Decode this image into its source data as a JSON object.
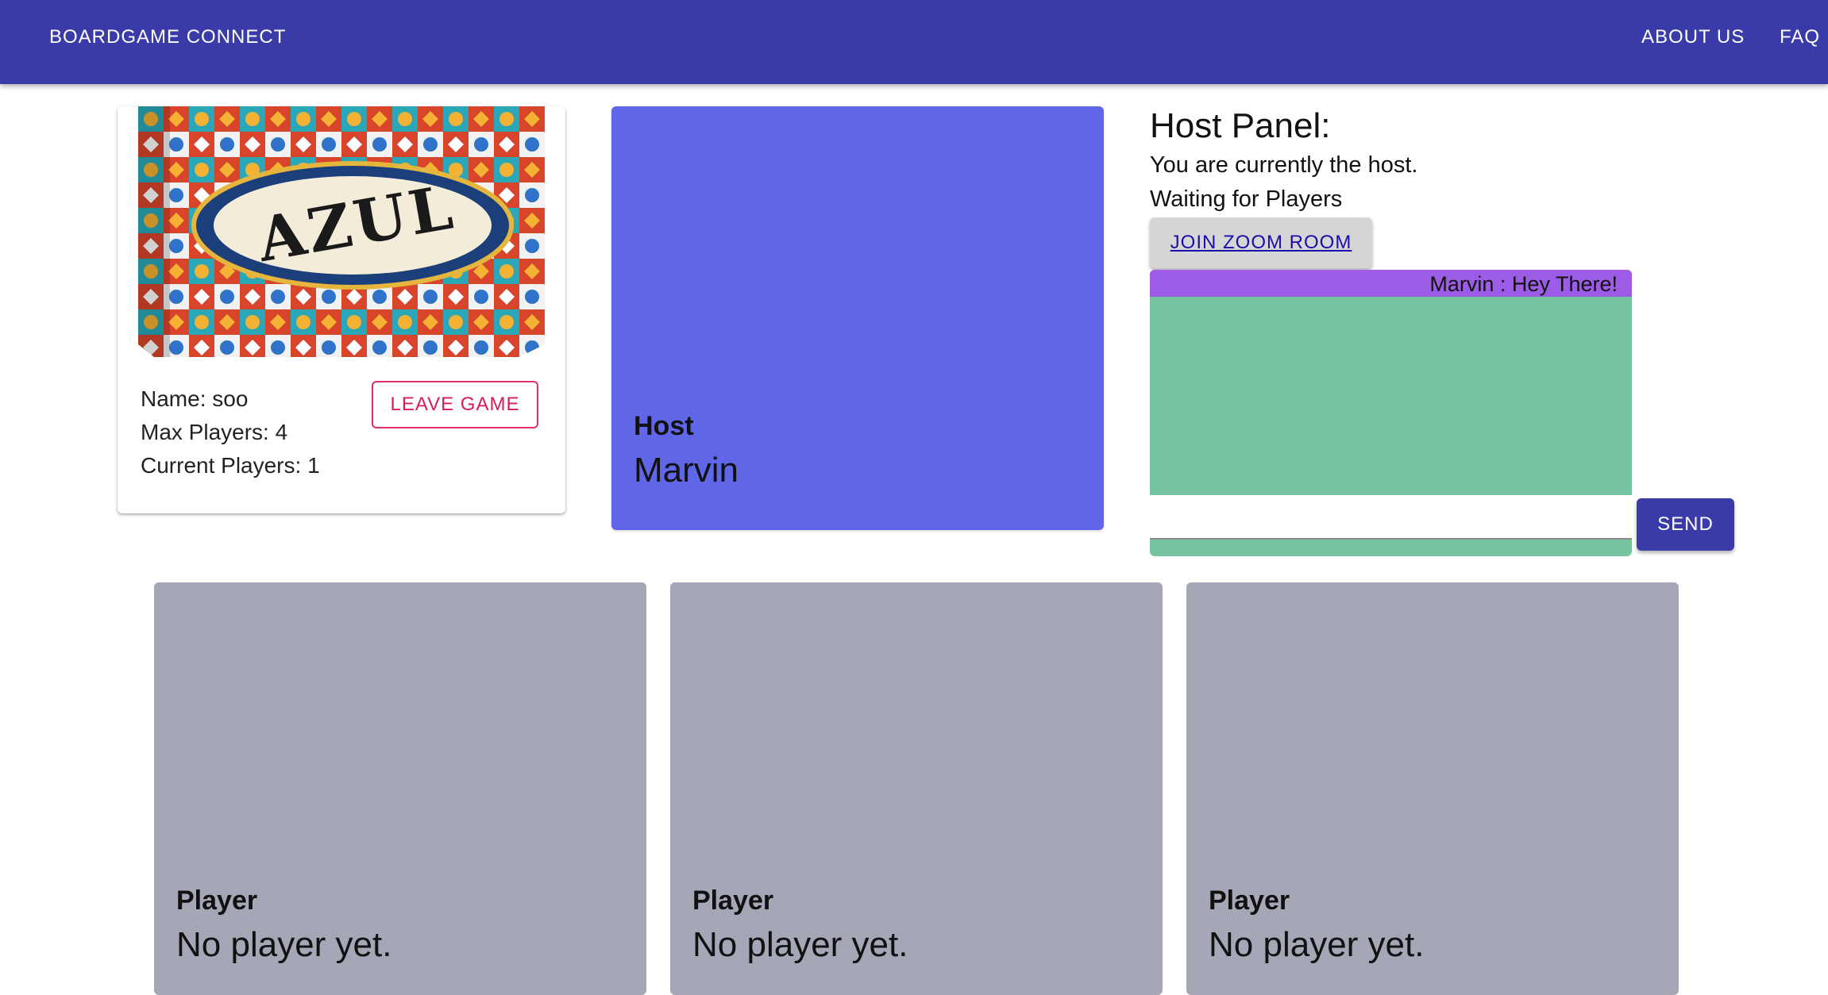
{
  "appbar": {
    "brand": "BOARDGAME CONNECT",
    "nav": [
      "ABOUT US",
      "FAQ"
    ],
    "color": "#3a3aa8"
  },
  "game": {
    "image_alt": "AZUL",
    "name_line": "Name: soo",
    "max_players_line": "Max Players: 4",
    "current_players_line": "Current Players: 1",
    "leave_label": "LEAVE GAME"
  },
  "host_tile": {
    "role": "Host",
    "name": "Marvin",
    "color": "#5f67e8"
  },
  "host_panel": {
    "title": "Host Panel:",
    "status_line": "You are currently the host.",
    "waiting_line": "Waiting for Players",
    "zoom_label": "JOIN ZOOM ROOM"
  },
  "chat": {
    "messages": [
      "Marvin : Hey There!"
    ],
    "input_value": "",
    "send_label": "SEND",
    "background": "#79c4a0",
    "message_color": "#9d5ce6"
  },
  "players": [
    {
      "role": "Player",
      "name": "No player yet."
    },
    {
      "role": "Player",
      "name": "No player yet."
    },
    {
      "role": "Player",
      "name": "No player yet."
    }
  ]
}
